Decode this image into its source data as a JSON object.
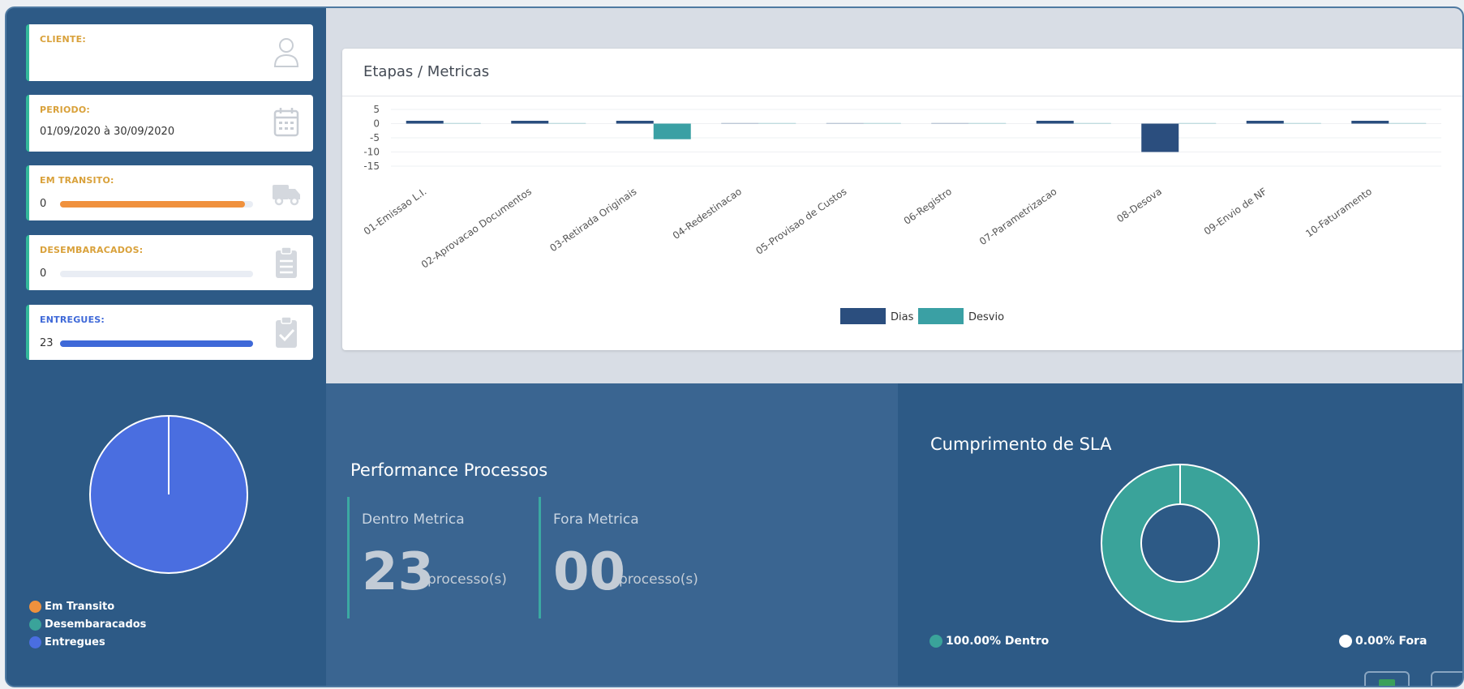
{
  "kpis": {
    "cliente": {
      "label": "CLIENTE:",
      "value": "",
      "icon": "user-icon"
    },
    "periodo": {
      "label": "PERIODO:",
      "value": "01/09/2020 à 30/09/2020",
      "icon": "calendar-icon"
    },
    "em_transito": {
      "label": "EM TRANSITO:",
      "value": "0",
      "progress": 0.96,
      "color": "#f0913d",
      "icon": "truck-icon"
    },
    "desembaracados": {
      "label": "DESEMBARACADOS:",
      "value": "0",
      "progress": 0,
      "color": "#e9edf4",
      "icon": "clipboard-icon"
    },
    "entregues": {
      "label": "ENTREGUES:",
      "value": "23",
      "progress": 1,
      "color": "#3f69d8",
      "icon": "clipboard-check-icon"
    }
  },
  "status_pie": {
    "legend": [
      {
        "label": "Em Transito",
        "color": "#f0913d"
      },
      {
        "label": "Desembaracados",
        "color": "#3aa39a"
      },
      {
        "label": "Entregues",
        "color": "#4a6ee0"
      }
    ]
  },
  "metrics_chart": {
    "title": "Etapas / Metricas"
  },
  "chart_data": [
    {
      "type": "bar",
      "title": "Etapas / Metricas",
      "categories": [
        "01-Emissao L.I.",
        "02-Aprovacao Documentos",
        "03-Retirada Originais",
        "04-Redestinacao",
        "05-Provisao de Custos",
        "06-Registro",
        "07-Parametrizacao",
        "08-Desova",
        "09-Envio de NF",
        "10-Faturamento"
      ],
      "series": [
        {
          "name": "Dias",
          "color": "#2b4e7e",
          "values": [
            1,
            1,
            1,
            0,
            0,
            0,
            1,
            -10,
            1,
            1
          ]
        },
        {
          "name": "Desvio",
          "color": "#3aa0a4",
          "values": [
            0,
            0,
            -5.5,
            0,
            0,
            0,
            0,
            0,
            0,
            0
          ]
        }
      ],
      "yticks": [
        5,
        0,
        -5,
        -10,
        -15
      ],
      "ylim": [
        -15,
        5
      ],
      "grid": true,
      "legend": "bottom"
    },
    {
      "type": "pie",
      "categories": [
        "Em Transito",
        "Desembaracados",
        "Entregues"
      ],
      "values": [
        0,
        0,
        23
      ],
      "legend": "bottom-left"
    },
    {
      "type": "pie",
      "title": "Cumprimento de SLA",
      "categories": [
        "Dentro",
        "Fora"
      ],
      "values": [
        100,
        0
      ],
      "legend": "bottom"
    }
  ],
  "performance": {
    "title": "Performance Processos",
    "dentro": {
      "label": "Dentro Metrica",
      "value": "23",
      "unit": "processo(s)"
    },
    "fora": {
      "label": "Fora Metrica",
      "value": "00",
      "unit": "processo(s)"
    }
  },
  "sla": {
    "title": "Cumprimento de SLA",
    "dentro_label": "100.00% Dentro",
    "fora_label": "0.00% Fora",
    "dentro_color": "#3aa39a",
    "fora_color": "#ffffff"
  }
}
